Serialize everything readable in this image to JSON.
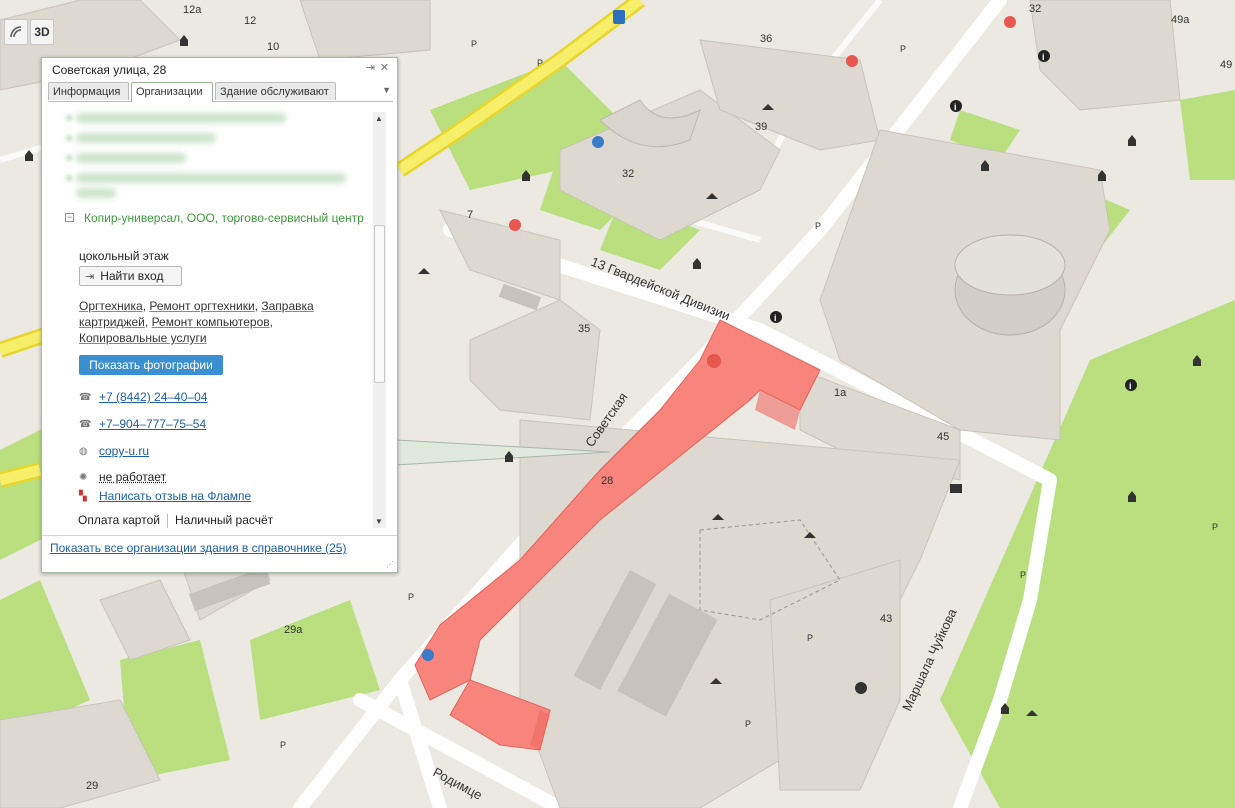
{
  "map": {
    "street_labels": [
      "13 Гвардейской Дивизии",
      "Советская",
      "Маршала Чуйкова",
      "Родимце"
    ],
    "house_numbers": [
      "12а",
      "12",
      "10",
      "36",
      "39",
      "32",
      "7",
      "35",
      "1а",
      "45",
      "28",
      "29а",
      "43",
      "29",
      "49а",
      "49",
      "32"
    ],
    "parking_label": "P",
    "colors": {
      "selected_building": "#f7857d",
      "park": "#b9df7f",
      "road_major": "#f5e94a",
      "road": "#ffffff",
      "building": "#e2ded6",
      "ground": "#ece9e2"
    }
  },
  "controls": {
    "three_d": "3D",
    "ruler_icon": "ruler-icon"
  },
  "popup": {
    "title": "Советская улица, 28",
    "tabs": [
      "Информация",
      "Организации",
      "Здание обслуживают"
    ],
    "active_tab": "Организации",
    "org": {
      "name": "Копир-универсал, ООО, торгово-сервисный центр",
      "floor": "цокольный этаж",
      "find_entrance": "Найти вход",
      "rubrics": [
        "Оргтехника",
        "Ремонт оргтехники",
        "Заправка картриджей",
        "Ремонт компьютеров",
        "Копировальные услуги"
      ],
      "show_photos": "Показать фотографии",
      "phone1": "+7 (8442) 24–40–04",
      "phone2": "+7–904–777–75–54",
      "website": "copy-u.ru",
      "hours": "не работает",
      "review": "Написать отзыв на Флампе",
      "payment": [
        "Оплата картой",
        "Наличный расчёт"
      ]
    },
    "footer_link": "Показать все организации здания в справочнике",
    "footer_count": "(25)"
  }
}
